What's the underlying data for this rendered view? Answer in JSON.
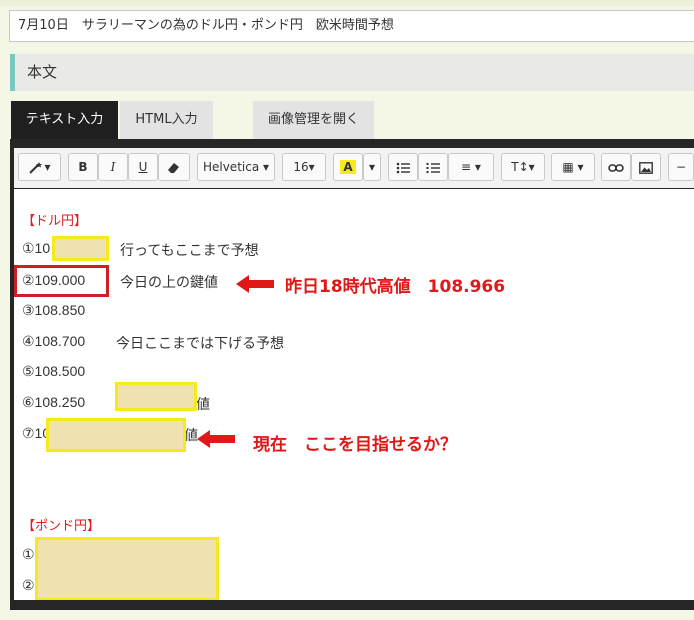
{
  "title_field": {
    "value": "7月10日　サラリーマンの為のドル円・ポンド円　欧米時間予想"
  },
  "section": {
    "label": "本文"
  },
  "tabs": [
    {
      "label": "テキスト入力",
      "active": true
    },
    {
      "label": "HTML入力",
      "active": false
    },
    {
      "label": "画像管理を開く",
      "active": false
    }
  ],
  "toolbar": {
    "magic_label": "▾",
    "bold": "B",
    "italic": "I",
    "underline": "U",
    "font_family": "Helvetica ▾",
    "font_size": "16▾",
    "color_label": "A",
    "color_dd": "▾",
    "align_label": "≡ ▾",
    "text_height": "T↕▾",
    "table_label": "▦ ▾",
    "minus": "−"
  },
  "content": {
    "dollar_head": "【ドル円】",
    "lines": [
      {
        "prefix": "①10",
        "text": "行ってもここまで予想"
      },
      {
        "prefix": "②109.000",
        "text": "今日の上の鍵値"
      },
      {
        "prefix": "③108.850",
        "text": ""
      },
      {
        "prefix": "④108.700",
        "text": "今日ここまでは下げる予想"
      },
      {
        "prefix": "⑤108.500",
        "text": ""
      },
      {
        "prefix": "⑥108.250",
        "text": "値"
      },
      {
        "prefix": "⑦10",
        "text": "値"
      }
    ],
    "pound_head": "【ポンド円】",
    "pound_lines": [
      "①",
      "②"
    ]
  },
  "annotations": {
    "note1": "昨日18時代高値　108.966",
    "note2": "現在　ここを目指せるか？"
  },
  "colors": {
    "highlight_fill": "#f0e1b0",
    "highlight_border": "#f5ea1c",
    "red": "#e01818",
    "accent_bar": "#7bc8c2"
  }
}
